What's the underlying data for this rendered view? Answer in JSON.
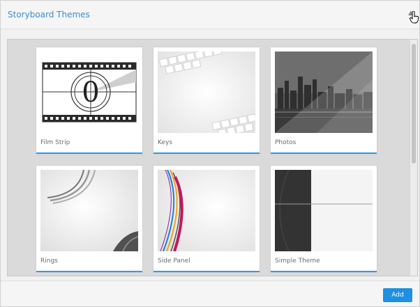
{
  "dialog": {
    "title": "Storyboard Themes",
    "collapse_icon": "caret-up-icon",
    "collapse_glyph": "▲"
  },
  "themes": [
    {
      "label": "Film Strip"
    },
    {
      "label": "Keys"
    },
    {
      "label": "Photos"
    },
    {
      "label": "Rings"
    },
    {
      "label": "Side Panel"
    },
    {
      "label": "Simple Theme"
    }
  ],
  "footer": {
    "add_label": "Add"
  },
  "colors": {
    "accent": "#2c9ce8",
    "title": "#3d8ccf",
    "button": "#1e90e0"
  }
}
